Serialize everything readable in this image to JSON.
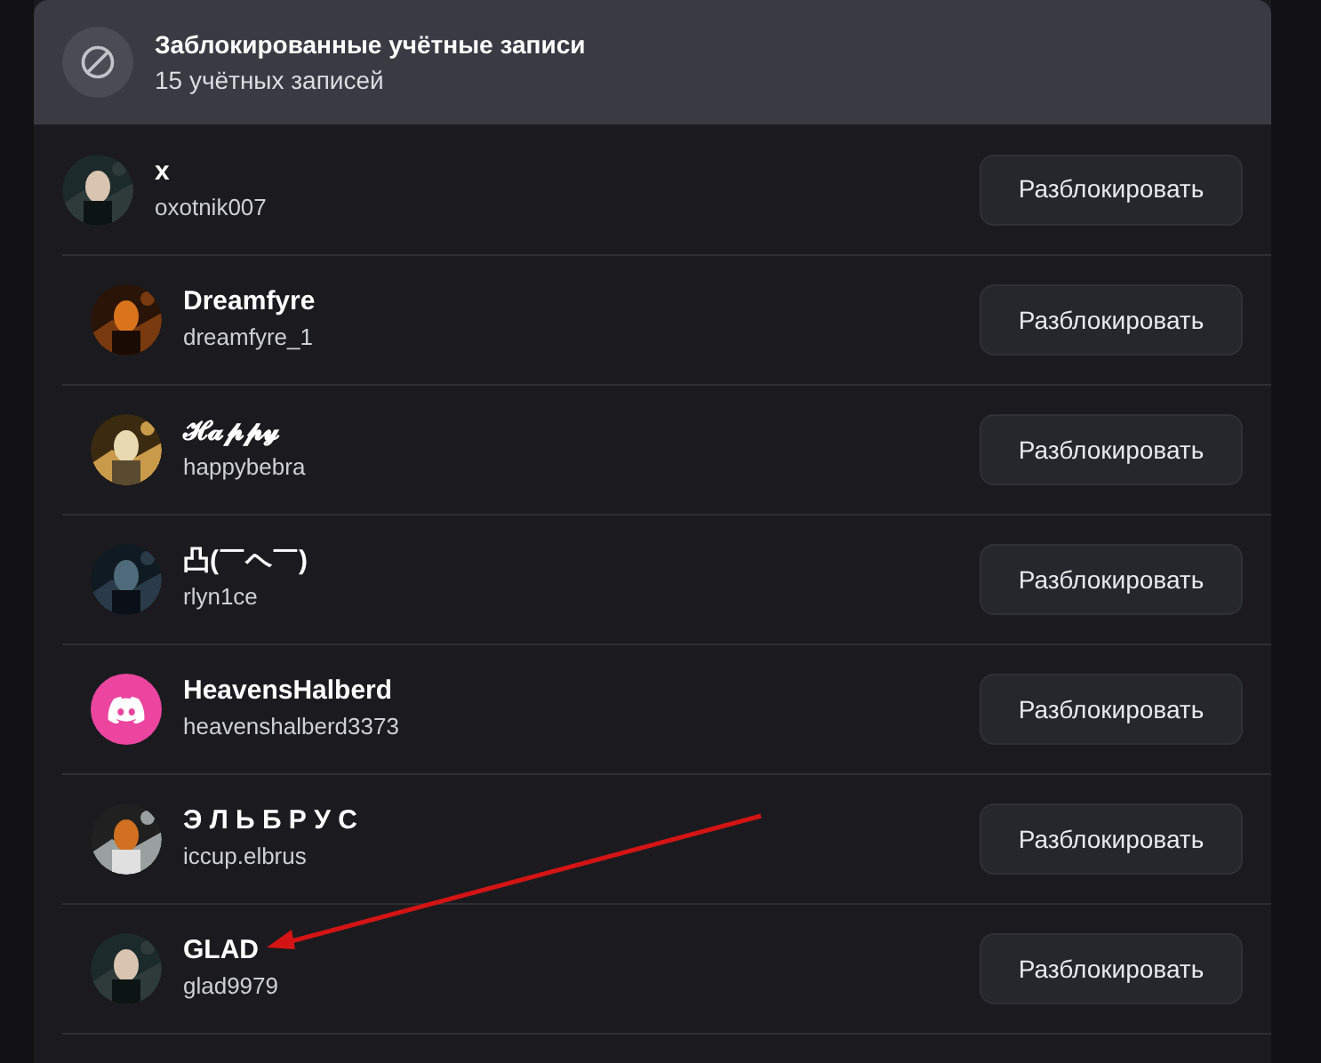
{
  "header": {
    "title": "Заблокированные учётные записи",
    "subtitle": "15 учётных записей"
  },
  "blocked_users": [
    {
      "display_name": "x",
      "username": "oxotnik007",
      "button": "Разблокировать"
    },
    {
      "display_name": "Dreamfyre",
      "username": "dreamfyre_1",
      "button": "Разблокировать"
    },
    {
      "display_name": "𝓗𝓪𝓹𝓹𝔂",
      "username": "happybebra",
      "button": "Разблокировать"
    },
    {
      "display_name": "凸(￣ヘ￣)",
      "username": "rlyn1ce",
      "button": "Разблокировать"
    },
    {
      "display_name": "HeavensHalberd",
      "username": "heavenshalberd3373",
      "avatar": {
        "kind": "default",
        "color": "#eb459f"
      },
      "button": "Разблокировать"
    },
    {
      "display_name": "Э Л Ь Б Р У С",
      "username": "iccup.elbrus",
      "button": "Разблокировать"
    },
    {
      "display_name": "GLAD",
      "username": "glad9979",
      "button": "Разблокировать"
    }
  ]
}
